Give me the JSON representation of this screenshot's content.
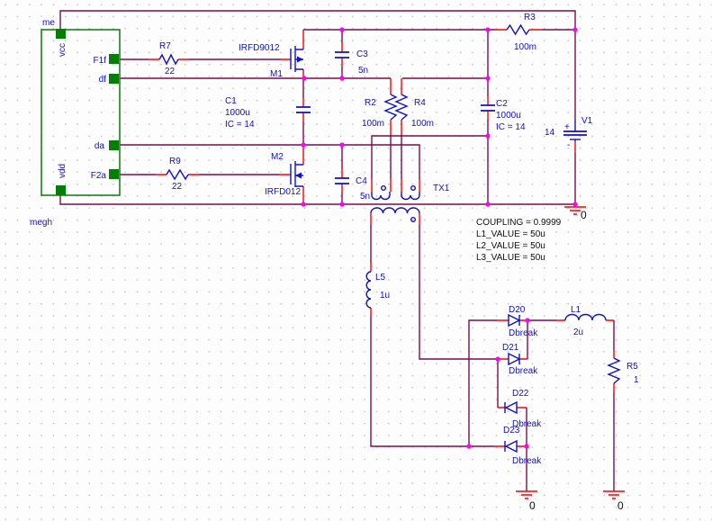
{
  "colors": {
    "wire": "#7b0b4e",
    "terminal": "#ff0000",
    "symbol": "#1010c8",
    "junction": "#ff00ff",
    "block": "#067d06",
    "annotation": "#111111",
    "background": "#fdfdfe"
  },
  "hierarchical_block": {
    "ref": "me",
    "net_label": "megh",
    "pins": {
      "vcc": "vcc",
      "f1f": "F1f",
      "df": "df",
      "da": "da",
      "f2a": "F2a",
      "vdd": "vdd"
    }
  },
  "parts": {
    "r7": {
      "ref": "R7",
      "value": "22"
    },
    "r9": {
      "ref": "R9",
      "value": "22"
    },
    "r2": {
      "ref": "R2",
      "value": "100m"
    },
    "r3": {
      "ref": "R3",
      "value": "100m"
    },
    "r4": {
      "ref": "R4",
      "value": "100m"
    },
    "r5": {
      "ref": "R5",
      "value": "1"
    },
    "c1": {
      "ref": "C1",
      "value": "1000u",
      "ic": "IC = 14"
    },
    "c2": {
      "ref": "C2",
      "value": "1000u",
      "ic": "IC = 14"
    },
    "c3": {
      "ref": "C3",
      "value": "5n"
    },
    "c4": {
      "ref": "C4",
      "value": "5n"
    },
    "m1": {
      "ref": "M1",
      "model": "IRFD9012"
    },
    "m2": {
      "ref": "M2",
      "model": "IRFD012"
    },
    "tx1": {
      "ref": "TX1"
    },
    "l1": {
      "ref": "L1",
      "value": "2u"
    },
    "l5": {
      "ref": "L5",
      "value": "1u"
    },
    "d20": {
      "ref": "D20",
      "model": "Dbreak"
    },
    "d21": {
      "ref": "D21",
      "model": "Dbreak"
    },
    "d22": {
      "ref": "D22",
      "model": "Dbreak"
    },
    "d23": {
      "ref": "D23",
      "model": "Dbreak"
    },
    "v1": {
      "ref": "V1",
      "value": "14",
      "plus": "+",
      "minus": "-"
    }
  },
  "tx1_properties": {
    "coupling": "COUPLING = 0.9999",
    "l1": "L1_VALUE = 50u",
    "l2": "L2_VALUE = 50u",
    "l3": "L3_VALUE = 50u"
  },
  "ground_label": "0"
}
